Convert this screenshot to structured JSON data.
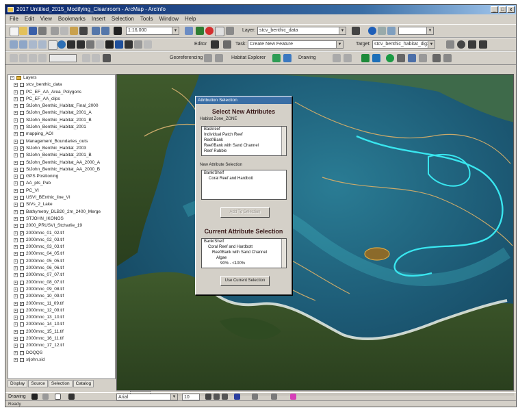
{
  "window": {
    "title": "2017 Untitled_2015_Modifying_Cleanroom - ArcMap - ArcInfo"
  },
  "menus": [
    "File",
    "Edit",
    "View",
    "Bookmarks",
    "Insert",
    "Selection",
    "Tools",
    "Window",
    "Help"
  ],
  "toolbar": {
    "scale_value": "1:16,000",
    "layer_label": "Layer:",
    "layer_value": "stcv_benthic_data",
    "editor_label": "Editor",
    "task_label": "Task:",
    "task_value": "Create New Feature",
    "target_label": "Target:",
    "target_value": "stcv_benthic_habitat_dig3",
    "georef_label": "Georeferencing",
    "habitat_label": "Habitat Explorer",
    "draw_label": "Drawing",
    "font_value": "Arial",
    "font_size": "10"
  },
  "toc": {
    "root_label": "Layers",
    "layers": [
      {
        "label": "stcv_benthic_data",
        "checked": false
      },
      {
        "label": "PC_EF_AA_Area_Polygons",
        "checked": false
      },
      {
        "label": "PC_EF_AA_clips",
        "checked": false
      },
      {
        "label": "StJohn_Benthic_Habitat_Final_2000",
        "checked": false
      },
      {
        "label": "StJohn_Benthic_Habitat_2001_A",
        "checked": false
      },
      {
        "label": "StJohn_Benthic_Habitat_2001_B",
        "checked": false
      },
      {
        "label": "StJohn_Benthic_Habitat_2001",
        "checked": false
      },
      {
        "label": "mapping_AOI",
        "checked": false
      },
      {
        "label": "Management_Boundaries_outs",
        "checked": false
      },
      {
        "label": "StJohn_Benthic_Habitat_2003",
        "checked": true
      },
      {
        "label": "StJohn_Benthic_Habitat_2001_B",
        "checked": false
      },
      {
        "label": "StJohn_Benthic_Habitat_AA_2000_A",
        "checked": false
      },
      {
        "label": "StJohn_Benthic_Habitat_AA_2000_B",
        "checked": false
      },
      {
        "label": "GPS Positioning",
        "checked": false
      },
      {
        "label": "AA_pts_Pub",
        "checked": false
      },
      {
        "label": "PC_VI",
        "checked": false
      },
      {
        "label": "USVI_BEnthic_line_VI",
        "checked": false
      },
      {
        "label": "StVs_2_Lake",
        "checked": false
      },
      {
        "label": "Bathymetry_DLB20_2m_2400_Merge",
        "checked": false
      },
      {
        "label": "STJOHN_IKONOS",
        "checked": false
      },
      {
        "label": "2000_PRUSVI_Stcharlie_19",
        "checked": false
      },
      {
        "label": "2000mnc_01_02.tif",
        "checked": true
      },
      {
        "label": "2000mnc_02_03.tif",
        "checked": false
      },
      {
        "label": "2000mnc_03_03.tif",
        "checked": false
      },
      {
        "label": "2000mnc_04_05.tif",
        "checked": false
      },
      {
        "label": "2000mnc_05_05.tif",
        "checked": false
      },
      {
        "label": "2000mnc_06_06.tif",
        "checked": false
      },
      {
        "label": "2000mnc_07_07.tif",
        "checked": false
      },
      {
        "label": "2000mnc_08_07.tif",
        "checked": false
      },
      {
        "label": "2000mnc_09_08.tif",
        "checked": false
      },
      {
        "label": "2000mnc_10_09.tif",
        "checked": false
      },
      {
        "label": "2000mnc_11_09.tif",
        "checked": true
      },
      {
        "label": "2000mnc_12_09.tif",
        "checked": false
      },
      {
        "label": "2000mnc_13_10.tif",
        "checked": false
      },
      {
        "label": "2000mnc_14_10.tif",
        "checked": false
      },
      {
        "label": "2000mnc_15_11.tif",
        "checked": false
      },
      {
        "label": "2000mnc_16_11.tif",
        "checked": false
      },
      {
        "label": "2000mnc_17_12.tif",
        "checked": false
      },
      {
        "label": "DOQQS",
        "checked": false
      },
      {
        "label": "stjohn.sid",
        "checked": false
      }
    ],
    "tabs": [
      "Display",
      "Source",
      "Selection",
      "Catalog"
    ]
  },
  "dialog": {
    "title": "Attribution Selection",
    "select_header": "Select New Attributes",
    "habitat_zone_label": "Habitat Zone_ZONE",
    "zone_items": [
      "Backreef",
      "Individual Patch Reef",
      "Reef/Bank",
      "Reef/Bank with Sand Channel",
      "Reef Rubble"
    ],
    "new_selection_label": "New Attribute Selection",
    "new_selection_items": [
      "Bank/Shelf",
      "Coral Reef and Hardbott"
    ],
    "add_button": "Add To Selection",
    "current_header": "Current Attribute Selection",
    "current_items": [
      "Bank/Shelf",
      "Coral Reef and Hardbott",
      "Reef/Bank with Sand Channel",
      "Algae",
      "90% - <100%"
    ],
    "use_button": "Use Current Selection"
  },
  "status": {
    "left": "Ready"
  },
  "map": {
    "outline_color": "#c9a96a",
    "selected_color": "#39e6ef"
  }
}
